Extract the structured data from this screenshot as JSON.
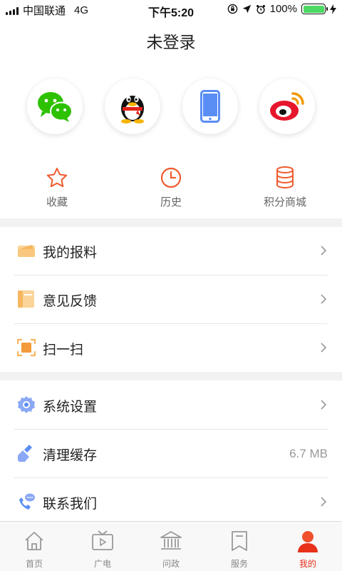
{
  "status_bar": {
    "carrier": "中国联通",
    "network": "4G",
    "time": "下午5:20",
    "battery": "100%"
  },
  "title": "未登录",
  "login_options": [
    {
      "icon": "wechat-icon",
      "color": "#2dc100"
    },
    {
      "icon": "qq-icon",
      "color": "#000000"
    },
    {
      "icon": "phone-icon",
      "color": "#5b8ef5"
    },
    {
      "icon": "weibo-icon",
      "color": "#e6162d"
    }
  ],
  "quick_links": [
    {
      "label": "收藏",
      "icon": "star-icon"
    },
    {
      "label": "历史",
      "icon": "clock-icon"
    },
    {
      "label": "积分商城",
      "icon": "database-icon"
    }
  ],
  "menu_group_1": [
    {
      "label": "我的报料",
      "icon": "envelope-icon"
    },
    {
      "label": "意见反馈",
      "icon": "notebook-icon"
    },
    {
      "label": "扫一扫",
      "icon": "scan-icon"
    }
  ],
  "menu_group_2": [
    {
      "label": "系统设置",
      "icon": "gear-icon"
    },
    {
      "label": "清理缓存",
      "icon": "brush-icon",
      "value": "6.7 MB"
    },
    {
      "label": "联系我们",
      "icon": "phone-chat-icon"
    }
  ],
  "tabs": [
    {
      "label": "首页",
      "icon": "home-icon"
    },
    {
      "label": "广电",
      "icon": "tv-icon"
    },
    {
      "label": "问政",
      "icon": "government-icon"
    },
    {
      "label": "服务",
      "icon": "bookmark-icon"
    },
    {
      "label": "我的",
      "icon": "user-icon",
      "active": true
    }
  ],
  "colors": {
    "accent": "#e8301b",
    "divider": "#e6e6e6",
    "section_gap": "#f2f2f2"
  }
}
